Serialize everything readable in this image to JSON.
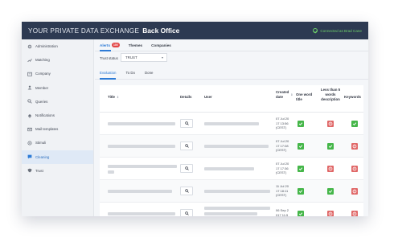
{
  "header": {
    "brand": "YOUR PRIVATE DATA EXCHANGE",
    "section": "Back Office",
    "connection": "Connected as Brad Cane"
  },
  "sidebar": {
    "items": [
      {
        "label": "Administration",
        "icon": "gear-icon"
      },
      {
        "label": "Matching",
        "icon": "chart-icon"
      },
      {
        "label": "Company",
        "icon": "building-icon"
      },
      {
        "label": "Member",
        "icon": "person-icon"
      },
      {
        "label": "Queries",
        "icon": "search-icon"
      },
      {
        "label": "Notifications",
        "icon": "bell-icon"
      },
      {
        "label": "Mail templates",
        "icon": "mail-icon"
      },
      {
        "label": "Stimuli",
        "icon": "stimuli-icon"
      },
      {
        "label": "Cleaning",
        "icon": "chat-icon"
      },
      {
        "label": "Trust",
        "icon": "shield-icon"
      }
    ],
    "active": "Cleaning"
  },
  "tabs": {
    "alerts": "Alerts",
    "alerts_count": "100",
    "themes": "Themes",
    "companies": "Companies"
  },
  "filter": {
    "label": "Trust status",
    "value": "TRUST"
  },
  "subtabs": {
    "evaluation": "Evaluation",
    "todo": "To Do",
    "done": "Done"
  },
  "table": {
    "headers": {
      "title": "Title",
      "details": "Details",
      "user": "User",
      "created_date": "Created date",
      "one_word": "One word title",
      "less_than": "Less than 5 words description",
      "keywords": "Keywords"
    },
    "rows": [
      {
        "date": [
          "07 Jul 20",
          "17 13:56",
          "(CEST)"
        ],
        "one_word": "ok",
        "less_than": "bad",
        "keywords": "ok"
      },
      {
        "date": [
          "07 Jul 20",
          "17 17:08",
          "(CEST)"
        ],
        "one_word": "ok",
        "less_than": "ok",
        "keywords": "bad"
      },
      {
        "date": [
          "07 Jul 20",
          "17 17:36",
          "(CEST)"
        ],
        "one_word": "ok",
        "less_than": "bad",
        "keywords": "bad"
      },
      {
        "date": [
          "11 Jul 20",
          "17 18:11",
          "(CEST)"
        ],
        "one_word": "ok",
        "less_than": "ok",
        "keywords": "bad"
      },
      {
        "date": [
          "06 Sep 2",
          "017 11:5"
        ],
        "one_word": "ok",
        "less_than": "bad",
        "keywords": "bad"
      }
    ]
  },
  "colors": {
    "topbar": "#2d3a52",
    "accent": "#2d7bd6",
    "ok": "#45b649",
    "bad": "#e06767",
    "badge": "#e24545"
  }
}
